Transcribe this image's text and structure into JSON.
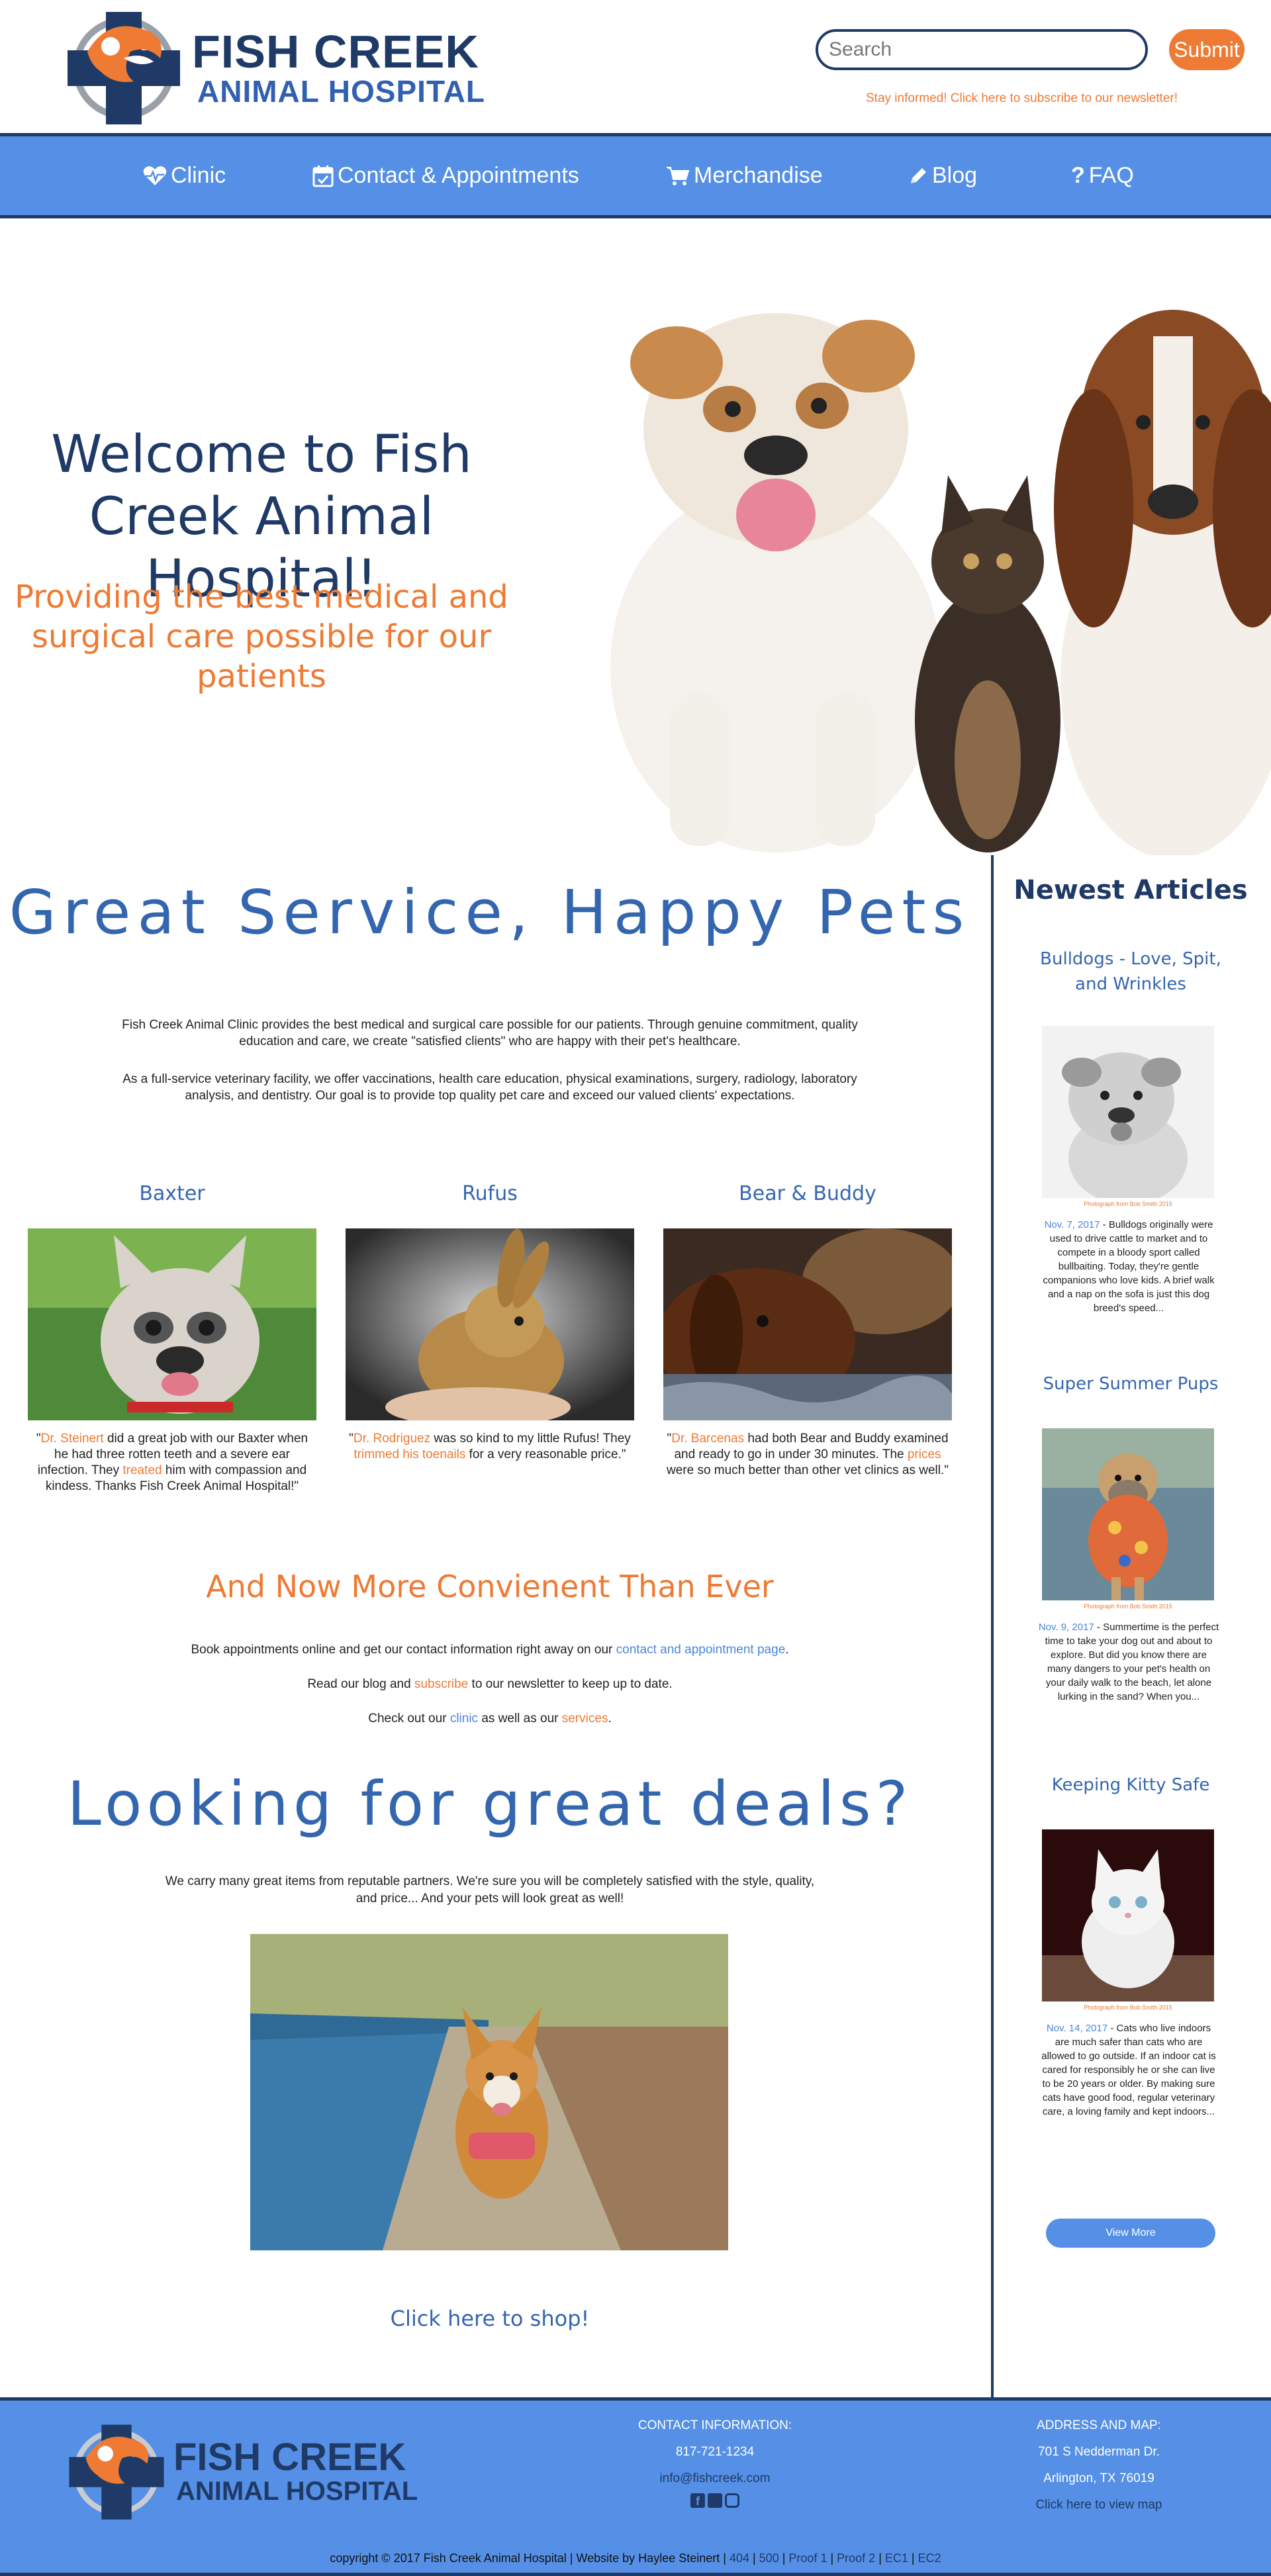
{
  "header": {
    "logo_line1": "FISH CREEK",
    "logo_line2": "ANIMAL HOSPITAL",
    "search_placeholder": "Search",
    "submit_label": "Submit",
    "newsletter_link": "Stay informed! Click here to subscribe to our newsletter!"
  },
  "nav": {
    "items": [
      {
        "label": "Clinic",
        "icon": "heartbeat-icon"
      },
      {
        "label": "Contact & Appointments",
        "icon": "calendar-icon"
      },
      {
        "label": "Merchandise",
        "icon": "cart-icon"
      },
      {
        "label": "Blog",
        "icon": "pencil-icon"
      },
      {
        "label": "FAQ",
        "icon": "question-icon"
      }
    ]
  },
  "hero": {
    "title": "Welcome to Fish Creek Animal Hospital!",
    "subtitle": "Providing the best medical and surgical care possible for our patients"
  },
  "intro": {
    "heading": "Great Service, Happy Pets",
    "para1": "Fish Creek Animal Clinic provides the best medical and surgical care possible for our patients. Through genuine commitment, quality education and care, we create \"satisfied clients\" who are happy with their pet's healthcare.",
    "para2": "As a full-service veterinary facility, we offer vaccinations, health care education, physical examinations, surgery, radiology, laboratory analysis, and dentistry. Our goal is to provide top quality pet care and exceed our valued clients' expectations."
  },
  "testimonials": [
    {
      "name": "Baxter",
      "q_open": "\"",
      "doctor": "Dr. Steinert",
      "q1": " did a great job with our Baxter when he had three rotten teeth and a severe ear infection. They ",
      "link": "treated",
      "q2": " him with compassion and kindess. Thanks Fish Creek Animal Hospital!\""
    },
    {
      "name": "Rufus",
      "q_open": "\"",
      "doctor": "Dr. Rodriguez",
      "q1": " was so kind to my little Rufus! They ",
      "link": "trimmed his toenails",
      "q2": " for a very reasonable price.\""
    },
    {
      "name": "Bear & Buddy",
      "q_open": "\"",
      "doctor": "Dr. Barcenas",
      "q1": " had both Bear and Buddy examined and ready to go in under 30 minutes. The ",
      "link": "prices",
      "q2": " were so much better than other vet clinics as well.\""
    }
  ],
  "convenient": {
    "heading": "And Now More Convienent Than Ever",
    "line1_pre": "Book appointments online and get our contact information right away on our ",
    "line1_link": "contact and appointment page",
    "line1_post": ".",
    "line2_pre": "Read our blog and ",
    "line2_link": "subscribe",
    "line2_post": " to our newsletter to keep up to date.",
    "line3_pre": "Check out our ",
    "line3_link1": "clinic",
    "line3_mid": " as well as our ",
    "line3_link2": "services",
    "line3_post": "."
  },
  "deals": {
    "heading": "Looking for great deals?",
    "text": "We carry many great items from reputable partners. We're sure you will be completely satisfied with the style, quality, and price... And your pets will look great as well!",
    "shop_link": "Click here to shop!"
  },
  "sidebar": {
    "title": "Newest Articles",
    "articles": [
      {
        "title": "Bulldogs - Love, Spit, and Wrinkles",
        "credit": "Photograph from Bob Smith 2015",
        "date": "Nov. 7, 2017",
        "excerpt": " - Bulldogs originally were used to drive cattle to market and to compete in a bloody sport called bullbaiting. Today, they're gentle companions who love kids. A brief walk and a nap on the sofa is just this dog breed's speed..."
      },
      {
        "title": "Super Summer Pups",
        "credit": "Photograph from Bob Smith 2015",
        "date": "Nov. 9, 2017",
        "excerpt": " - Summertime is the perfect time to take your dog out and about to explore. But did you know there are many dangers to your pet's health on your daily walk to the beach, let alone lurking in the sand? When you..."
      },
      {
        "title": "Keeping Kitty Safe",
        "credit": "Photograph from Bob Smith 2015",
        "date": "Nov. 14, 2017",
        "excerpt": " - Cats who live indoors are much safer than cats who are allowed to go outside. If an indoor cat is cared for responsibly he or she can live to be 20 years or older. By making sure cats have good food, regular veterinary care, a loving family and kept indoors..."
      }
    ],
    "view_more": "View More"
  },
  "footer": {
    "logo_line1": "FISH CREEK",
    "logo_line2": "ANIMAL HOSPITAL",
    "contact_heading": "CONTACT INFORMATION:",
    "phone": "817-721-1234",
    "email": "info@fishcreek.com",
    "address_heading": "ADDRESS AND MAP:",
    "street": "701 S Nedderman Dr.",
    "city": "Arlington, TX 76019",
    "map_link": "Click here to view map",
    "copyright": "copyright © 2017 Fish Creek Animal Hospital | Website by Haylee Steinert |",
    "page_links": [
      "404",
      "500",
      "Proof 1",
      "Proof 2",
      "EC1",
      "EC2"
    ]
  },
  "colors": {
    "navy": "#1f3a66",
    "blue": "#5590e6",
    "heading_blue": "#3466b0",
    "orange": "#ee7a33"
  }
}
